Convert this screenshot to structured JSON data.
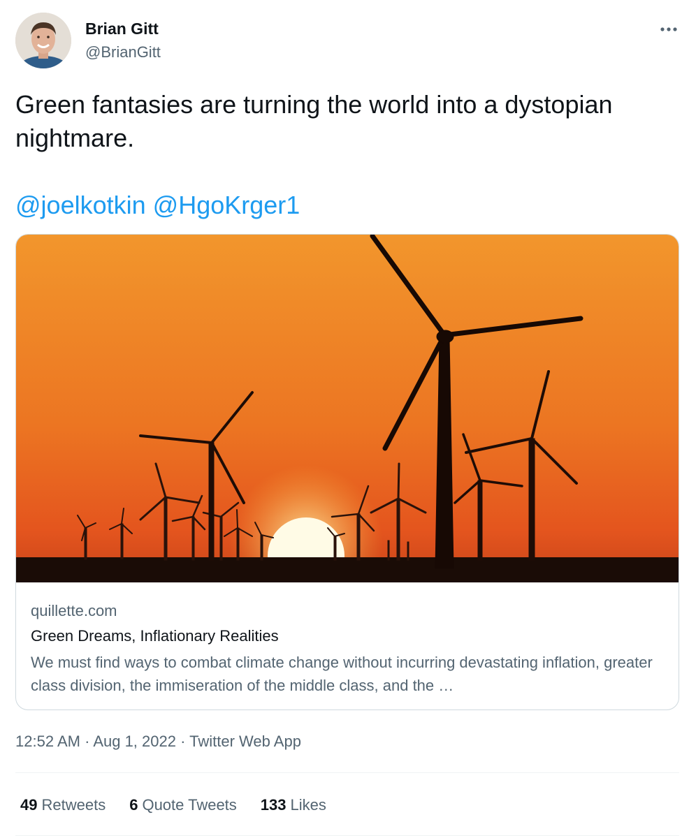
{
  "author": {
    "display_name": "Brian Gitt",
    "handle": "@BrianGitt",
    "avatar_icon": "profile-photo"
  },
  "more_icon": "more-horizontal-icon",
  "tweet": {
    "text": "Green fantasies are turning the world into a dystopian nightmare.",
    "mentions": [
      "@joelkotkin",
      "@HgoKrger1"
    ]
  },
  "card": {
    "domain": "quillette.com",
    "title": "Green Dreams, Inflationary Realities",
    "description": "We must find ways to combat climate change without incurring devastating inflation, greater class division, the immiseration of the middle class, and the …"
  },
  "meta": {
    "time": "12:52 AM",
    "separator": "·",
    "date": "Aug 1, 2022",
    "source": "Twitter Web App"
  },
  "stats": {
    "retweets_count": "49",
    "retweets_label": "Retweets",
    "quotes_count": "6",
    "quotes_label": "Quote Tweets",
    "likes_count": "133",
    "likes_label": "Likes"
  },
  "colors": {
    "link": "#1d9bf0",
    "secondary_text": "#536471",
    "primary_text": "#0f1419",
    "border": "#cfd9de",
    "sky_top": "#f2962c",
    "sky_bottom": "#e4551e"
  }
}
